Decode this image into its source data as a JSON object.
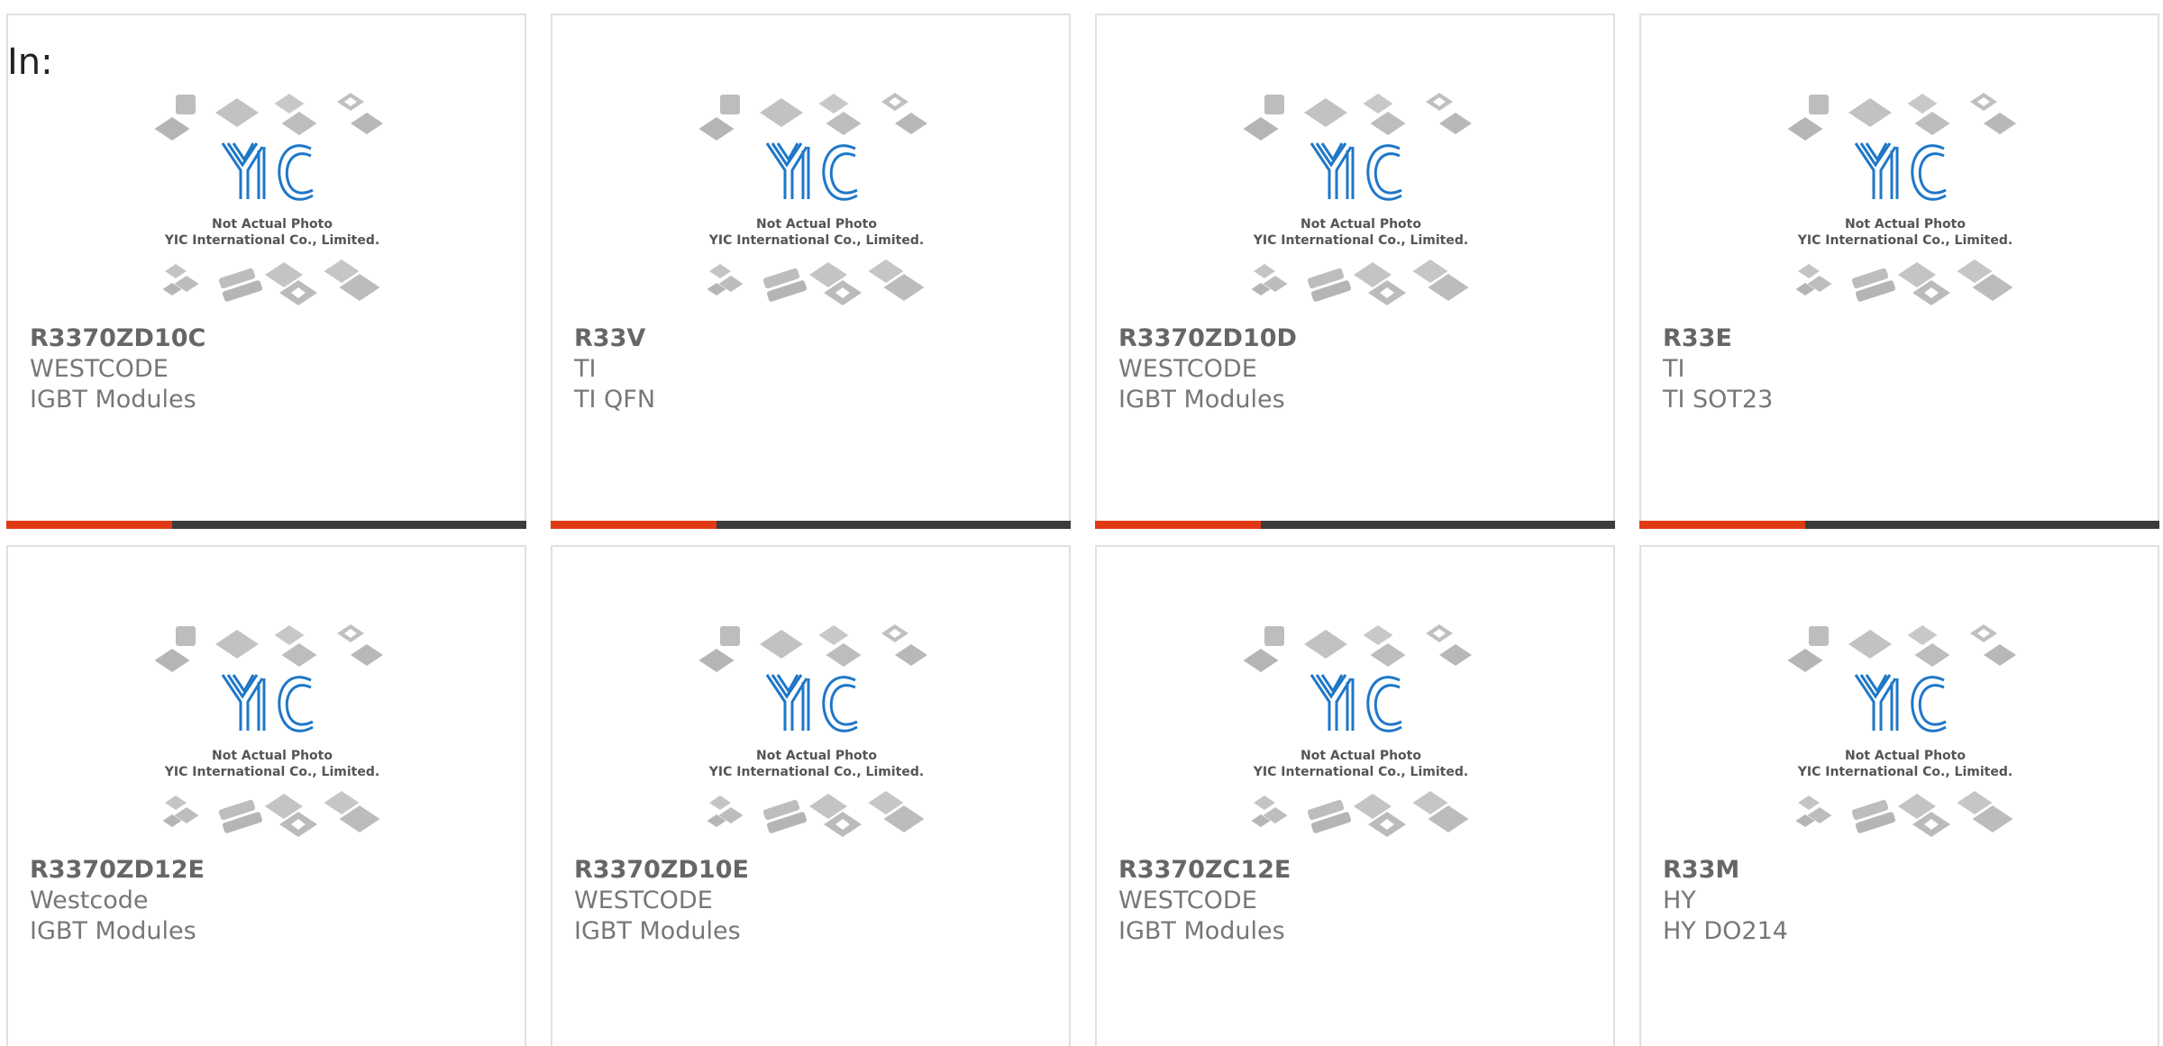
{
  "filter_label": "In:",
  "image_caption": {
    "line1": "Not Actual Photo",
    "line2": "YIC International Co., Limited.",
    "logo_text": "YIC"
  },
  "colors": {
    "accent": "#e03a14",
    "bar": "#3c3c3c",
    "logo_blue": "#1f77c8"
  },
  "products": [
    {
      "name": "R3370ZD10C",
      "manufacturer": "WESTCODE",
      "category": "IGBT Modules"
    },
    {
      "name": "R33V",
      "manufacturer": "TI",
      "category": "TI QFN"
    },
    {
      "name": "R3370ZD10D",
      "manufacturer": "WESTCODE",
      "category": "IGBT Modules"
    },
    {
      "name": "R33E",
      "manufacturer": "TI",
      "category": "TI SOT23"
    },
    {
      "name": "R3370ZD12E",
      "manufacturer": "Westcode",
      "category": "IGBT Modules"
    },
    {
      "name": "R3370ZD10E",
      "manufacturer": "WESTCODE",
      "category": "IGBT Modules"
    },
    {
      "name": "R3370ZC12E",
      "manufacturer": "WESTCODE",
      "category": "IGBT Modules"
    },
    {
      "name": "R33M",
      "manufacturer": "HY",
      "category": "HY DO214"
    }
  ]
}
